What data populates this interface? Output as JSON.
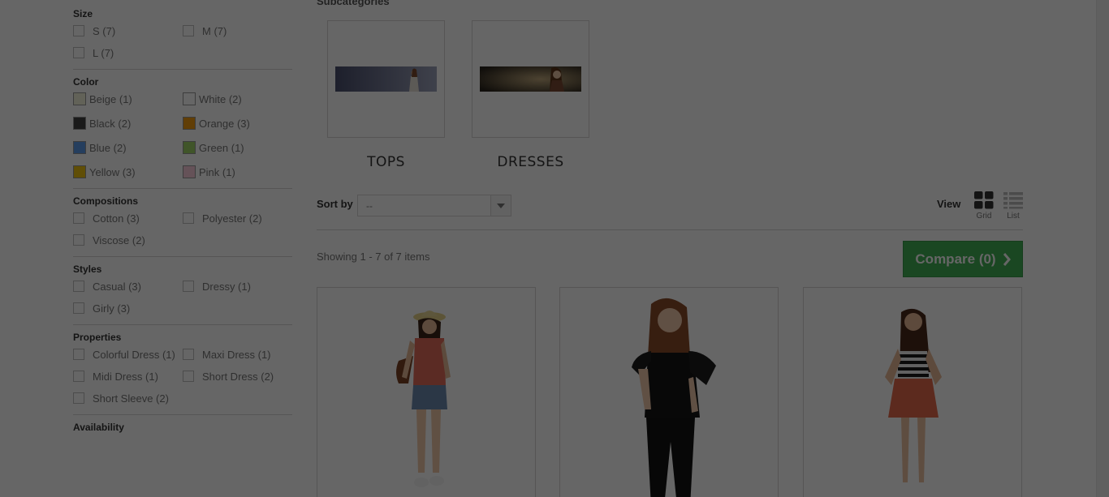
{
  "filters": {
    "size": {
      "title": "Size",
      "options": [
        {
          "label": "S (7)"
        },
        {
          "label": "M (7)"
        },
        {
          "label": "L (7)"
        }
      ]
    },
    "color": {
      "title": "Color",
      "options": [
        {
          "label": "Beige (1)",
          "swatch": "#f5f5dc"
        },
        {
          "label": "White (2)",
          "swatch": "#ffffff"
        },
        {
          "label": "Black (2)",
          "swatch": "#434343"
        },
        {
          "label": "Orange (3)",
          "swatch": "#f39c11"
        },
        {
          "label": "Blue (2)",
          "swatch": "#5d9cec"
        },
        {
          "label": "Green (1)",
          "swatch": "#a0d468"
        },
        {
          "label": "Yellow (3)",
          "swatch": "#f1c40f"
        },
        {
          "label": "Pink (1)",
          "swatch": "#fcccdc"
        }
      ]
    },
    "compositions": {
      "title": "Compositions",
      "options": [
        {
          "label": "Cotton (3)"
        },
        {
          "label": "Polyester (2)"
        },
        {
          "label": "Viscose (2)"
        }
      ]
    },
    "styles": {
      "title": "Styles",
      "options": [
        {
          "label": "Casual (3)"
        },
        {
          "label": "Dressy (1)"
        },
        {
          "label": "Girly (3)"
        }
      ]
    },
    "properties": {
      "title": "Properties",
      "options": [
        {
          "label": "Colorful Dress (1)"
        },
        {
          "label": "Maxi Dress (1)"
        },
        {
          "label": "Midi Dress (1)"
        },
        {
          "label": "Short Dress (2)"
        },
        {
          "label": "Short Sleeve (2)"
        }
      ]
    },
    "availability": {
      "title": "Availability"
    }
  },
  "main": {
    "subcategories_title": "Subcategories",
    "subcategories": [
      {
        "name": "TOPS"
      },
      {
        "name": "DRESSES"
      }
    ],
    "sort": {
      "label": "Sort by",
      "selected": "--"
    },
    "view": {
      "label": "View",
      "grid": "Grid",
      "list": "List"
    },
    "showing": "Showing 1 - 7 of 7 items",
    "compare_label": "Compare (0)"
  },
  "colors": {
    "accent_green": "#43b155",
    "overlay": "rgba(0,0,0,0.6)"
  }
}
